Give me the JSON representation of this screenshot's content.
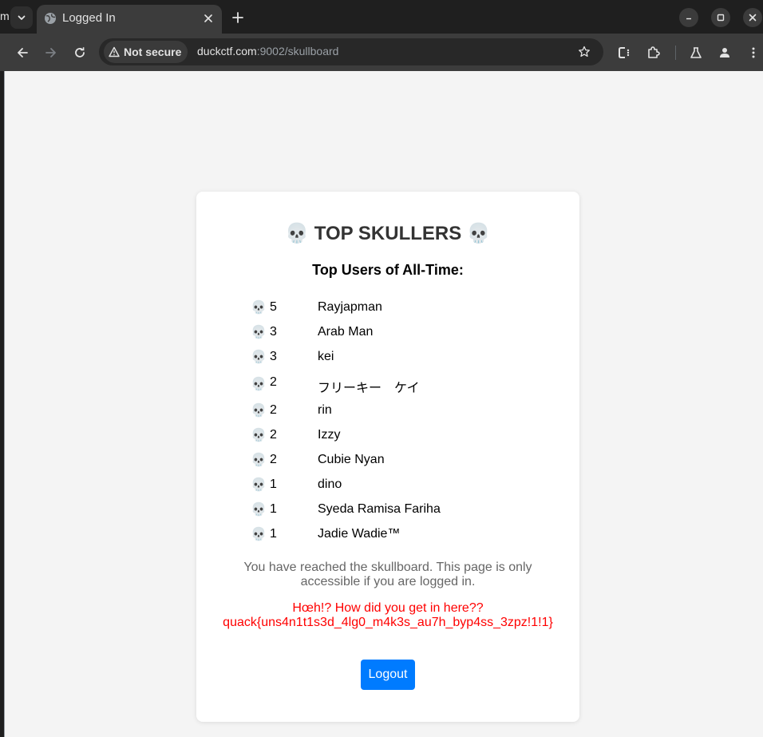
{
  "browser": {
    "prev_tab_fragment": "m",
    "tab": {
      "title": "Logged In",
      "favicon": "globe-icon"
    },
    "security_label": "Not secure",
    "url_host": "duckctf.com",
    "url_rest": ":9002/skullboard",
    "icons": {
      "tab_search": "chevron-down-icon",
      "tab_close": "close-icon",
      "new_tab": "plus-icon",
      "minimize": "minimize-icon",
      "maximize": "maximize-icon",
      "close": "close-icon",
      "back": "arrow-left-icon",
      "forward": "arrow-right-icon",
      "reload": "reload-icon",
      "warning": "warning-icon",
      "bookmark": "star-icon",
      "cast": "cast-icon",
      "extensions": "puzzle-icon",
      "labs": "flask-icon",
      "profile": "person-icon",
      "menu": "kebab-menu-icon"
    }
  },
  "page": {
    "title": "💀 TOP SKULLERS 💀",
    "subtitle": "Top Users of All-Time:",
    "skull": "💀",
    "users": [
      {
        "count": "5",
        "name": "Rayjapman"
      },
      {
        "count": "3",
        "name": "Arab Man"
      },
      {
        "count": "3",
        "name": "kei"
      },
      {
        "count": "2",
        "name": "フリーキー　ケイ"
      },
      {
        "count": "2",
        "name": "rin"
      },
      {
        "count": "2",
        "name": "Izzy"
      },
      {
        "count": "2",
        "name": "Cubie Nyan"
      },
      {
        "count": "1",
        "name": "dino"
      },
      {
        "count": "1",
        "name": "Syeda Ramisa Fariha"
      },
      {
        "count": "1",
        "name": "Jadie Wadie™"
      }
    ],
    "info_text": "You have reached the skullboard. This page is only accessible if you are logged in.",
    "flag_line1": "Hœh!? How did you get in here??",
    "flag_line2": "quack{uns4n1t1s3d_4lg0_m4k3s_au7h_byp4ss_3zpz!1!1}",
    "logout_label": "Logout"
  },
  "colors": {
    "page_bg": "#f4f4f4",
    "card_bg": "#ffffff",
    "button": "#007bff",
    "flag_text": "#ff0000",
    "info_text": "#666666",
    "chrome_dark": "#1f1f1f",
    "chrome_toolbar": "#3c3c3c"
  }
}
